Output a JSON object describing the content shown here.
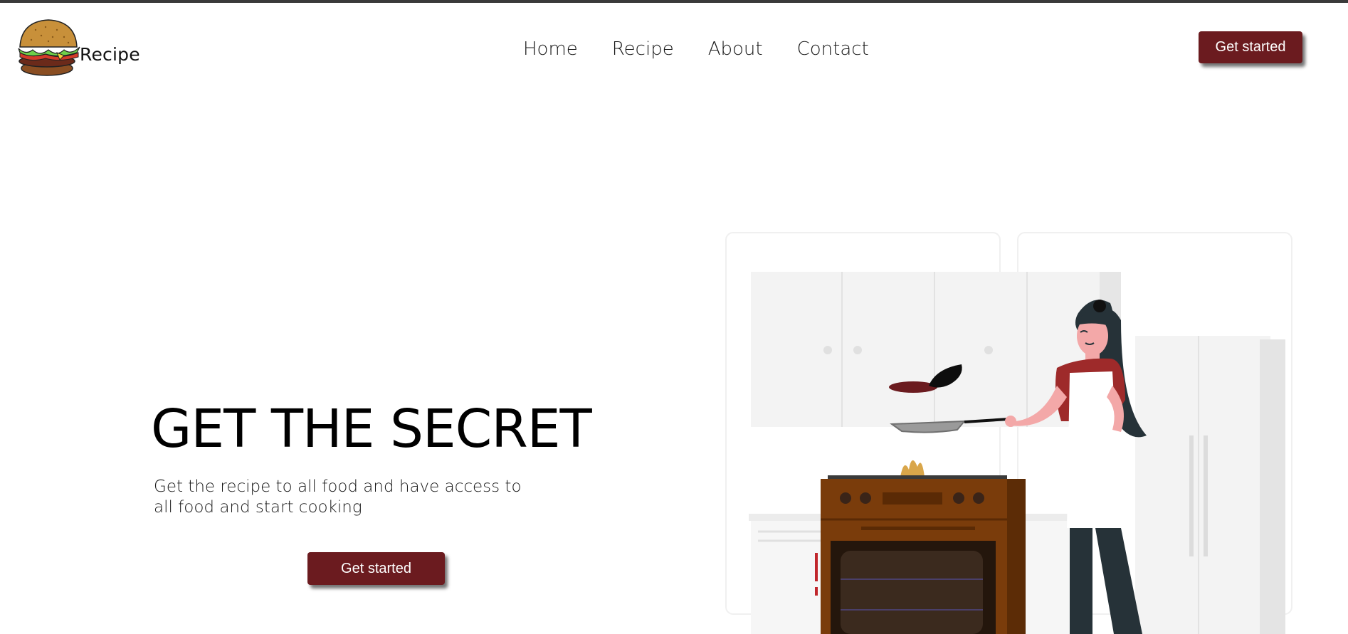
{
  "header": {
    "brand": "Recipe",
    "nav": [
      "Home",
      "Recipe",
      "About",
      "Contact"
    ],
    "cta_label": "Get started"
  },
  "hero": {
    "title": "GET THE SECRET",
    "subtitle": "Get the recipe to all food and have access to all food and start cooking",
    "cta_label": "Get started"
  },
  "colors": {
    "accent": "#6b1b1f",
    "text": "#111111",
    "top_rule": "#3a3a3a"
  },
  "icons": {
    "logo": "burger-logo-icon",
    "illustration": "chef-cooking-illustration"
  }
}
